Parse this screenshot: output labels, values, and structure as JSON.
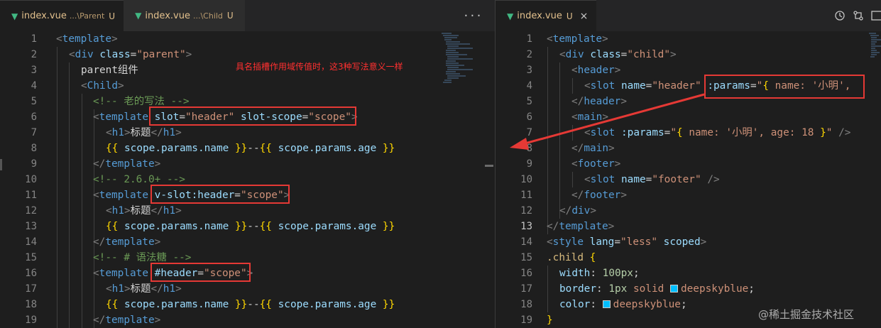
{
  "left_tabs": [
    {
      "name": "index.vue",
      "desc": "...\\Parent",
      "status": "U",
      "active": true
    },
    {
      "name": "index.vue",
      "desc": "...\\Child",
      "status": "U",
      "active": false
    }
  ],
  "right_tab": {
    "name": "index.vue",
    "status": "U",
    "close": "×"
  },
  "left_more": "···",
  "annotation": "具名插槽作用域传值时，这3种写法意义一样",
  "watermark": "@稀土掘金技术社区",
  "left_numbers": [
    "1",
    "2",
    "3",
    "4",
    "5",
    "6",
    "7",
    "8",
    "9",
    "10",
    "11",
    "12",
    "13",
    "14",
    "15",
    "16",
    "17",
    "18",
    "19"
  ],
  "right_numbers": [
    "1",
    "2",
    "3",
    "4",
    "5",
    "6",
    "7",
    "8",
    "9",
    "10",
    "11",
    "12",
    "13",
    "14",
    "15",
    "16",
    "17",
    "18",
    "19"
  ],
  "left_code": {
    "l1_tag": "template",
    "l2_tag": "div",
    "l2_attr": "class",
    "l2_val": "\"parent\"",
    "l3_text": "parent组件",
    "l4_tag": "Child",
    "l5_comment": "<!-- 老的写法 -->",
    "l6_tag": "template",
    "l6_attr1": "slot",
    "l6_val1": "\"header\"",
    "l6_attr2": "slot-scope",
    "l6_val2": "\"scope\"",
    "l7_tag": "h1",
    "l7_text": "标题",
    "l8_expr1": "scope.params.name",
    "l8_sep": "--",
    "l8_expr2": "scope.params.age",
    "l9_tag": "template",
    "l10_comment": "<!-- 2.6.0+ -->",
    "l11_tag": "template",
    "l11_attr": "v-slot:header",
    "l11_val": "\"scope\"",
    "l12_tag": "h1",
    "l12_text": "标题",
    "l13_expr1": "scope.params.name",
    "l13_sep": "--",
    "l13_expr2": "scope.params.age",
    "l14_tag": "template",
    "l15_comment": "<!-- # 语法糖 -->",
    "l16_tag": "template",
    "l16_attr": "#header",
    "l16_val": "\"scope\"",
    "l17_tag": "h1",
    "l17_text": "标题",
    "l18_expr1": "scope.params.name",
    "l18_sep": "--",
    "l18_expr2": "scope.params.age",
    "l19_tag": "template"
  },
  "right_code": {
    "l1_tag": "template",
    "l2_tag": "div",
    "l2_attr": "class",
    "l2_val": "\"child\"",
    "l3_tag": "header",
    "l4_tag": "slot",
    "l4_attr1": "name",
    "l4_val1": "\"header\"",
    "l4_attr2": ":params",
    "l4_val2a": "\"",
    "l4_val2b": " name: '小明',",
    "l5_tag": "header",
    "l6_tag": "main",
    "l7_tag": "slot",
    "l7_attr": ":params",
    "l7_val_a": "\"",
    "l7_val_b": " name: '小明', age: 18 ",
    "l7_val_c": "\"",
    "l8_tag": "main",
    "l9_tag": "footer",
    "l10_tag": "slot",
    "l10_attr": "name",
    "l10_val": "\"footer\"",
    "l11_tag": "footer",
    "l12_tag": "div",
    "l13_tag": "template",
    "l14_tag": "style",
    "l14_attr1": "lang",
    "l14_val1": "\"less\"",
    "l14_attr2": "scoped",
    "l15_sel": ".child",
    "l16_prop": "width",
    "l16_val": "100px",
    "l17_prop": "border",
    "l17_num": "1px",
    "l17_val": "solid",
    "l17_color": "deepskyblue",
    "l18_prop": "color",
    "l18_color": "deepskyblue"
  },
  "colors": {
    "swatch": "#00bfff",
    "box": "#e53935",
    "arrow": "#e53935"
  }
}
